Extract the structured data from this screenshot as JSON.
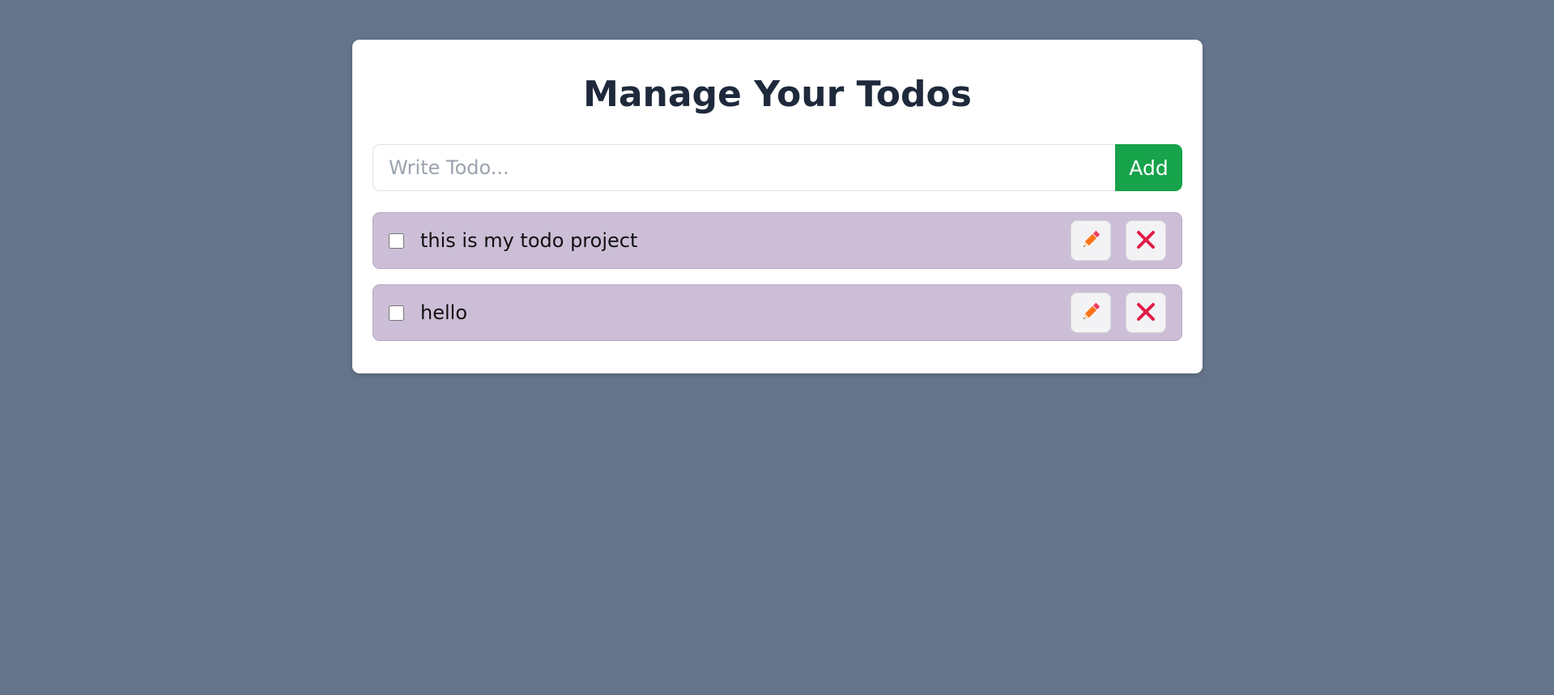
{
  "page": {
    "title": "Manage Your Todos"
  },
  "add_form": {
    "input_placeholder": "Write Todo...",
    "input_value": "",
    "add_label": "Add"
  },
  "todos": [
    {
      "text": "this is my todo project",
      "completed": false,
      "edit_icon": "pencil-icon",
      "delete_icon": "close-icon"
    },
    {
      "text": "hello",
      "completed": false,
      "edit_icon": "pencil-icon",
      "delete_icon": "close-icon"
    }
  ],
  "colors": {
    "background": "#64748b",
    "card": "#ffffff",
    "add_button": "#16a34a",
    "todo_item": "#ccbed7",
    "pencil": "#f97316",
    "close": "#e11d48"
  }
}
